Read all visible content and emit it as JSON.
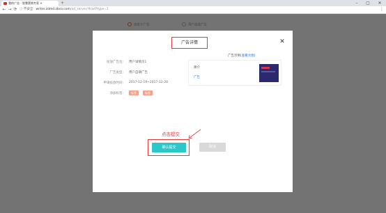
{
  "browser": {
    "tab_title": "我的广告 - 智慧营销专家 ×",
    "new_tab": "+",
    "window_controls": {
      "min": "–",
      "max": "▢",
      "close": "✕"
    },
    "nav": {
      "back": "←",
      "forward": "→",
      "reload": "⟳"
    },
    "url_security": "ⓘ 不安全",
    "url_host": "writer.zdmd.zbco.com",
    "url_path": "/ad_server/#/ad?type=1",
    "menu": "⋮"
  },
  "background_page": {
    "radio_1": "自定义广告",
    "radio_2": "用户自选广告"
  },
  "modal": {
    "title": "广告详情",
    "close": "✕",
    "fields": [
      {
        "label": "投放广告位:",
        "value": "用户详情页1"
      },
      {
        "label": "广告类型:",
        "value": "用户自填广告"
      },
      {
        "label": "申请投放时间:",
        "value": "2017-12-19~2017-12-20"
      },
      {
        "label": "添加标签:"
      }
    ],
    "tags": [
      "标签",
      "标签"
    ],
    "preview_label": "广告示例",
    "preview_link": "(查看大图)",
    "preview_text_1": "简介",
    "preview_text_2": "广告",
    "annotation": "点击提交",
    "confirm_label": "确认提交",
    "cancel_label": "取消"
  },
  "colors": {
    "accent": "#2ec7c9",
    "annotation_red": "#e53935",
    "tag": "#f4a08a"
  }
}
